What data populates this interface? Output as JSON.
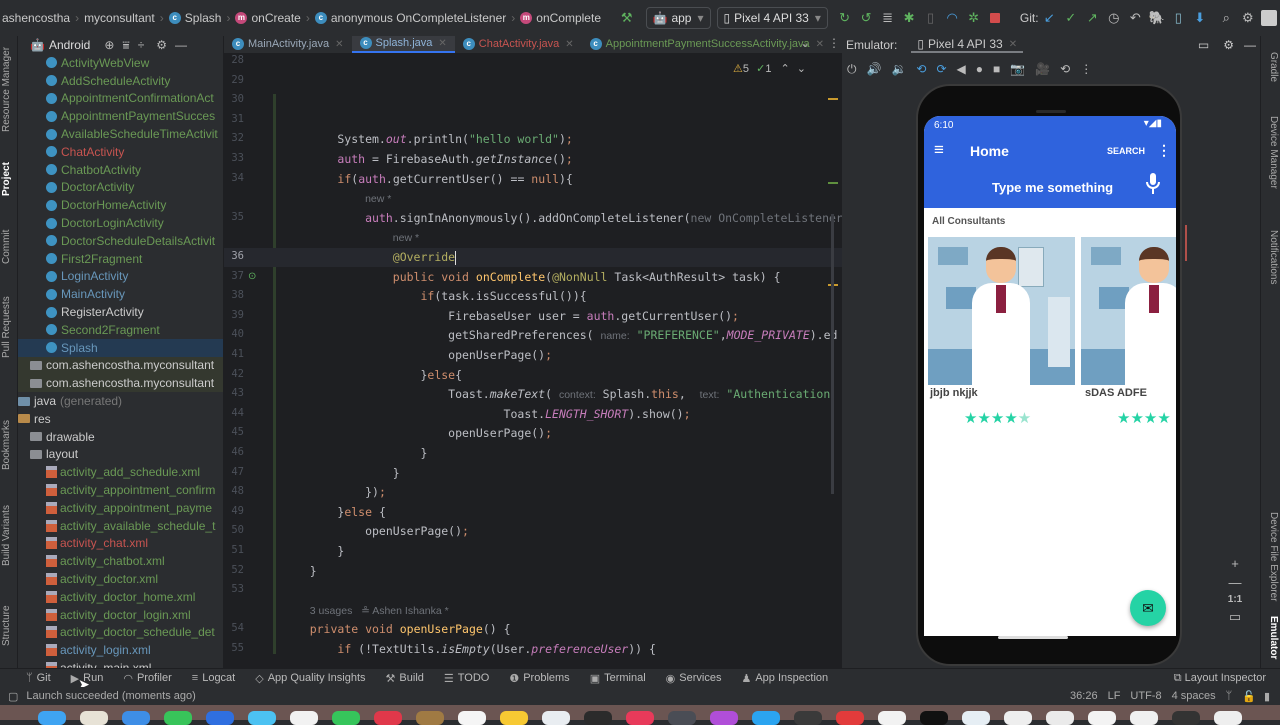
{
  "navbar": {
    "breadcrumbs": [
      {
        "label": "ashencostha",
        "icon": ""
      },
      {
        "label": "myconsultant",
        "icon": ""
      },
      {
        "label": "Splash",
        "icon": "class-icon"
      },
      {
        "label": "onCreate",
        "icon": "method-icon"
      },
      {
        "label": "anonymous OnCompleteListener",
        "icon": "anonymous-class-icon"
      },
      {
        "label": "onComplete",
        "icon": "method-icon"
      }
    ],
    "run_config": "app",
    "device": "Pixel 4 API 33",
    "git_label": "Git:"
  },
  "project_panel": {
    "view_mode": "Android",
    "items": [
      {
        "label": "ActivityWebView",
        "type": "class",
        "color": "#6a9955"
      },
      {
        "label": "AddScheduleActivity",
        "type": "class",
        "color": "#6a9955"
      },
      {
        "label": "AppointmentConfirmationAct",
        "type": "class",
        "color": "#6a9955"
      },
      {
        "label": "AppointmentPaymentSucces",
        "type": "class",
        "color": "#6a9955"
      },
      {
        "label": "AvailableScheduleTimeActivit",
        "type": "class",
        "color": "#6a9955"
      },
      {
        "label": "ChatActivity",
        "type": "class",
        "color": "#c75450"
      },
      {
        "label": "ChatbotActivity",
        "type": "class",
        "color": "#6a9955"
      },
      {
        "label": "DoctorActivity",
        "type": "class",
        "color": "#6a9955"
      },
      {
        "label": "DoctorHomeActivity",
        "type": "class",
        "color": "#6a9955"
      },
      {
        "label": "DoctorLoginActivity",
        "type": "class",
        "color": "#6a9955"
      },
      {
        "label": "DoctorScheduleDetailsActivit",
        "type": "class",
        "color": "#6a9955"
      },
      {
        "label": "First2Fragment",
        "type": "class",
        "color": "#6a9955"
      },
      {
        "label": "LoginActivity",
        "type": "class",
        "color": "#6897bb"
      },
      {
        "label": "MainActivity",
        "type": "class",
        "color": "#6897bb"
      },
      {
        "label": "RegisterActivity",
        "type": "class",
        "color": "#cccccc"
      },
      {
        "label": "Second2Fragment",
        "type": "class",
        "color": "#6a9955"
      },
      {
        "label": "Splash",
        "type": "class",
        "color": "#6897bb",
        "selected": true
      },
      {
        "label": "com.ashencostha.myconsultant",
        "type": "package",
        "color": "#cccccc"
      },
      {
        "label": "com.ashencostha.myconsultant",
        "type": "package",
        "color": "#cccccc"
      },
      {
        "label": "java",
        "suffix": "(generated)",
        "type": "root",
        "color": "#cccccc"
      },
      {
        "label": "res",
        "type": "root",
        "color": "#cccccc"
      },
      {
        "label": "drawable",
        "type": "folder",
        "color": "#cccccc"
      },
      {
        "label": "layout",
        "type": "folder",
        "color": "#cccccc"
      },
      {
        "label": "activity_add_schedule.xml",
        "type": "xml",
        "color": "#6a9955"
      },
      {
        "label": "activity_appointment_confirm",
        "type": "xml",
        "color": "#6a9955"
      },
      {
        "label": "activity_appointment_payme",
        "type": "xml",
        "color": "#6a9955"
      },
      {
        "label": "activity_available_schedule_t",
        "type": "xml",
        "color": "#6a9955"
      },
      {
        "label": "activity_chat.xml",
        "type": "xml",
        "color": "#c75450"
      },
      {
        "label": "activity_chatbot.xml",
        "type": "xml",
        "color": "#6a9955"
      },
      {
        "label": "activity_doctor.xml",
        "type": "xml",
        "color": "#6a9955"
      },
      {
        "label": "activity_doctor_home.xml",
        "type": "xml",
        "color": "#6a9955"
      },
      {
        "label": "activity_doctor_login.xml",
        "type": "xml",
        "color": "#6a9955"
      },
      {
        "label": "activity_doctor_schedule_det",
        "type": "xml",
        "color": "#6a9955"
      },
      {
        "label": "activity_login.xml",
        "type": "xml",
        "color": "#6897bb"
      },
      {
        "label": "activity_main.xml",
        "type": "xml",
        "color": "#cccccc"
      }
    ]
  },
  "left_strip": [
    "Resource Manager",
    "Project",
    "Commit",
    "Pull Requests",
    "Bookmarks",
    "Build Variants",
    "Structure"
  ],
  "editor_tabs": [
    {
      "label": "MainActivity.java",
      "color": "#9aa8b8",
      "active": false
    },
    {
      "label": "Splash.java",
      "color": "#8fb4d9",
      "active": true
    },
    {
      "label": "ChatActivity.java",
      "color": "#c75450",
      "active": false
    },
    {
      "label": "AppointmentPaymentSuccessActivity.java",
      "color": "#6a9955",
      "active": false
    }
  ],
  "inspections": {
    "warnings": "5",
    "typos": "1"
  },
  "code": {
    "current_line": "36",
    "lines": [
      {
        "n": "28",
        "html": ""
      },
      {
        "n": "29",
        "html": ""
      },
      {
        "n": "30",
        "html": ""
      },
      {
        "n": "31",
        "html": ""
      },
      {
        "n": "32",
        "html": "        System.<span class='fld it'>out</span>.println(<span class='str'>\"hello world\"</span>)<span class='kw'>;</span>"
      },
      {
        "n": "33",
        "html": "        <span class='fld'>auth</span> = FirebaseAuth.<span class='it'>getInstance</span>()<span class='kw'>;</span>"
      },
      {
        "n": "34",
        "html": "        <span class='kw'>if</span>(<span class='fld'>auth</span>.getCurrentUser() == <span class='kw'>null</span>){"
      },
      {
        "n": "",
        "html": "            <span class='hint'>new *</span>"
      },
      {
        "n": "35",
        "html": "            <span class='fld'>auth</span>.signInAnonymously().addOnCompleteListener(<span class='dim'>new OnCompleteListener</span>"
      },
      {
        "n": "",
        "html": "                <span class='hint'>new *</span>"
      },
      {
        "n": "36",
        "html": "                <span class='ann'>@Override</span>"
      },
      {
        "n": "37",
        "html": "                <span class='kw'>public void</span> <span class='fn' style='color:#ffc66d'>onComplete</span>(<span class='ann'>@NonNull</span> Task&lt;AuthResult&gt; task) {"
      },
      {
        "n": "38",
        "html": "                    <span class='kw'>if</span>(task.isSuccessful()){"
      },
      {
        "n": "39",
        "html": "                        FirebaseUser user = <span class='fld'>auth</span>.getCurrentUser()<span class='kw'>;</span>"
      },
      {
        "n": "40",
        "html": "                        getSharedPreferences( <span class='hint'>name:</span> <span class='str'>\"PREFERENCE\"</span>,<span class='fld it'>MODE_PRIVATE</span>).ed"
      },
      {
        "n": "41",
        "html": "                        openUserPage()<span class='kw'>;</span>"
      },
      {
        "n": "42",
        "html": "                    }<span class='kw'>else</span>{"
      },
      {
        "n": "43",
        "html": "                        Toast.<span class='it'>makeText</span>( <span class='hint'>context:</span> Splash.<span class='kw'>this</span>,  <span class='hint'>text:</span> <span class='str'>\"Authentication</span>"
      },
      {
        "n": "44",
        "html": "                                Toast.<span class='fld it'>LENGTH_SHORT</span>).show()<span class='kw'>;</span>"
      },
      {
        "n": "45",
        "html": "                        openUserPage()<span class='kw'>;</span>"
      },
      {
        "n": "46",
        "html": "                    }"
      },
      {
        "n": "47",
        "html": "                }"
      },
      {
        "n": "48",
        "html": "            })<span class='kw'>;</span>"
      },
      {
        "n": "49",
        "html": "        }<span class='kw'>else</span> {"
      },
      {
        "n": "50",
        "html": "            openUserPage()<span class='kw'>;</span>"
      },
      {
        "n": "51",
        "html": "        }"
      },
      {
        "n": "52",
        "html": "    }"
      },
      {
        "n": "53",
        "html": ""
      },
      {
        "n": "",
        "html": "    <span class='hint'>3 usages   ≗ Ashen Ishanka *</span>"
      },
      {
        "n": "54",
        "html": "    <span class='kw'>private void</span> <span style='color:#ffc66d'>openUserPage</span>() {"
      },
      {
        "n": "55",
        "html": "        <span class='kw'>if</span> (!TextUtils.<span class='it'>isEmpty</span>(User.<span class='fld it'>preferenceUser</span>)) {"
      }
    ]
  },
  "emulator": {
    "label": "Emulator:",
    "device_tab": "Pixel 4 API 33",
    "zoom_reset": "1:1"
  },
  "phone": {
    "time": "6:10",
    "appbar_title": "Home",
    "search_action": "SEARCH",
    "voice_prompt": "Type me something",
    "section_title": "All Consultants",
    "consultants": [
      {
        "name": "jbjb nkjjk",
        "rating": 4.5
      },
      {
        "name": "sDAS ADFE",
        "rating": 4
      }
    ],
    "accent": "#2f63dd",
    "fab_color": "#25d3a5"
  },
  "right_strip": [
    "Gradle",
    "Device Manager",
    "Notifications",
    "Device File Explorer",
    "Emulator"
  ],
  "bottom_tools": [
    {
      "label": "Git",
      "icon": "git-branch-icon",
      "glyph": "ᛘ"
    },
    {
      "label": "Run",
      "icon": "run-icon",
      "glyph": "▶"
    },
    {
      "label": "Profiler",
      "icon": "profiler-icon",
      "glyph": "◠"
    },
    {
      "label": "Logcat",
      "icon": "logcat-icon",
      "glyph": "≡"
    },
    {
      "label": "App Quality Insights",
      "icon": "diamond-icon",
      "glyph": "◇"
    },
    {
      "label": "Build",
      "icon": "hammer-icon",
      "glyph": "⚒"
    },
    {
      "label": "TODO",
      "icon": "list-icon",
      "glyph": "☰"
    },
    {
      "label": "Problems",
      "icon": "problems-icon",
      "glyph": "❶"
    },
    {
      "label": "Terminal",
      "icon": "terminal-icon",
      "glyph": "▣"
    },
    {
      "label": "Services",
      "icon": "services-icon",
      "glyph": "◉"
    },
    {
      "label": "App Inspection",
      "icon": "app-inspection-icon",
      "glyph": "♟"
    }
  ],
  "layout_inspector": "Layout Inspector",
  "status": {
    "message": "Launch succeeded (moments ago)",
    "position": "36:26",
    "line_sep": "LF",
    "encoding": "UTF-8",
    "indent": "4 spaces"
  }
}
